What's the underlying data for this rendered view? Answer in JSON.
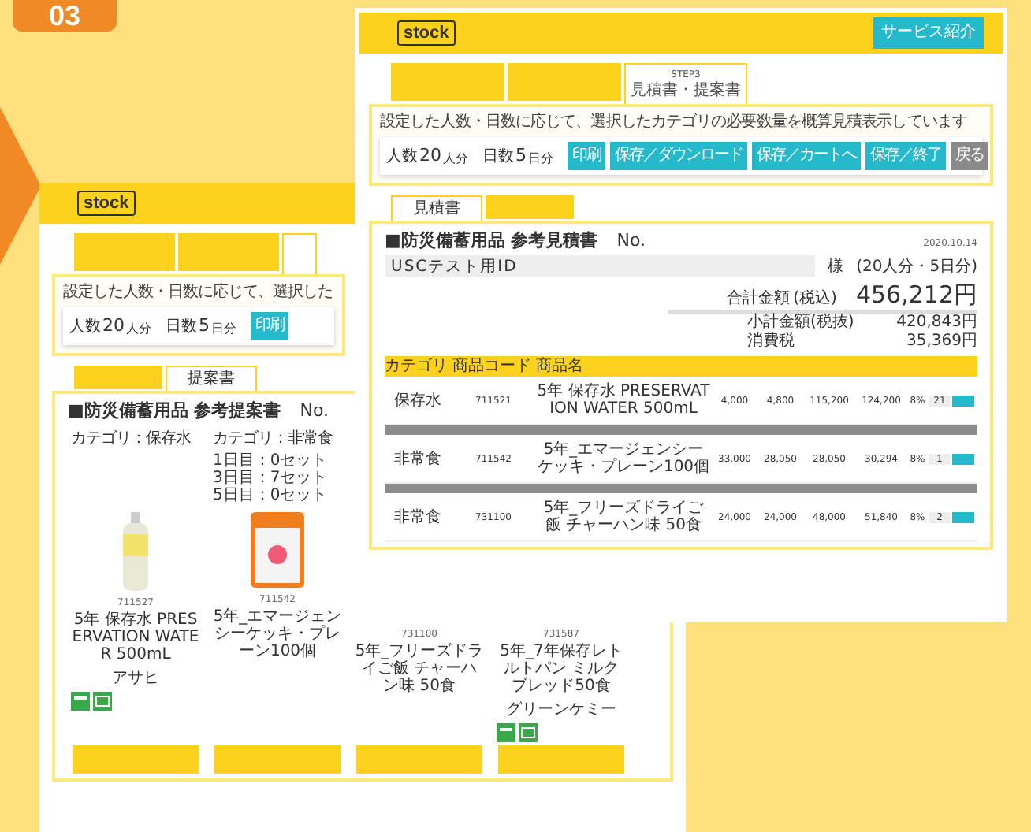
{
  "badge": "03",
  "back": {
    "logo": "stock",
    "steps": [
      {
        "selected": false
      },
      {
        "selected": false
      },
      {
        "selected": true
      }
    ],
    "description": "設定した人数・日数に応じて、選択した",
    "people": {
      "label": "人数",
      "value": "20",
      "unit": "人分"
    },
    "days": {
      "label": "日数",
      "value": "5",
      "unit": "日分"
    },
    "buttons": [
      "印刷"
    ],
    "doc_tabs": [
      {
        "selected": false
      },
      {
        "label": "提案書",
        "selected": true
      }
    ],
    "doc_title": "■防災備蓄用品 参考提案書",
    "doc_no": "No.",
    "cards": [
      {
        "kind": "bottle",
        "category": "カテゴリ：保存水",
        "code": "711527",
        "name": "5年 保存水 PRESERVATION WATER 500mL",
        "maker": "アサヒ",
        "certified": true
      },
      {
        "kind": "pack",
        "category": "カテゴリ：非常食",
        "schedule": [
          "1日目：0セット",
          "3日目：7セット",
          "5日目：0セット"
        ],
        "code": "711542",
        "name": "5年_エマージェンシーケッキ・プレーン100個",
        "certified": false
      },
      {
        "kind": "lower",
        "code": "731100",
        "name": "5年_フリーズドライご飯 チャーハン味 50食",
        "certified": false
      },
      {
        "kind": "lower",
        "code": "731587",
        "name": "5年_7年保存レトルトパン ミルクブレッド50食",
        "maker": "グリーンケミー",
        "certified": true
      }
    ]
  },
  "front": {
    "logo": "stock",
    "header_button": "サービス紹介",
    "steps": [
      {
        "selected": false
      },
      {
        "selected": false
      },
      {
        "selected": true,
        "step": "STEP3",
        "label": "見積書・提案書"
      }
    ],
    "description": "設定した人数・日数に応じて、選択したカテゴリの必要数量を概算見積表示しています",
    "people": {
      "label": "人数",
      "value": "20",
      "unit": "人分"
    },
    "days": {
      "label": "日数",
      "value": "5",
      "unit": "日分"
    },
    "buttons": [
      {
        "label": "印刷",
        "kind": "primary"
      },
      {
        "label": "保存／ダウンロード",
        "kind": "primary"
      },
      {
        "label": "保存／カートへ",
        "kind": "primary"
      },
      {
        "label": "保存／終了",
        "kind": "primary"
      },
      {
        "label": "戻る",
        "kind": "secondary"
      }
    ],
    "doc_tabs": [
      {
        "label": "見積書",
        "selected": true
      },
      {
        "selected": false
      }
    ],
    "doc_title": "■防災備蓄用品 参考見積書",
    "doc_no": "No.",
    "date": "2020.10.14",
    "customer": "USCテスト用ID",
    "honorific": "様",
    "scope": "(20人分・5日分)",
    "total_label": "合計金額",
    "total_note": "(税込)",
    "total": "456,212円",
    "subtotals": [
      {
        "label": "小計金額(税抜)",
        "value": "420,843円"
      },
      {
        "label": "消費税",
        "value": "35,369円"
      }
    ],
    "table": {
      "columns": [
        "カテゴリ",
        "商品コード",
        "商品名"
      ],
      "rows": [
        {
          "kind": "item",
          "cells": [
            "保存水",
            "711521",
            "5年 保存水 PRESERVATION WATER 500mL",
            "4,000",
            "4,800",
            "115,200",
            "124,200",
            "8%",
            "21"
          ]
        },
        {
          "kind": "summary"
        },
        {
          "kind": "item",
          "cells": [
            "非常食",
            "711542",
            "5年_エマージェンシーケッキ・プレーン100個",
            "33,000",
            "28,050",
            "28,050",
            "30,294",
            "8%",
            "1"
          ]
        },
        {
          "kind": "summary"
        },
        {
          "kind": "item",
          "cells": [
            "非常食",
            "731100",
            "5年_フリーズドライご飯 チャーハン味 50食",
            "24,000",
            "24,000",
            "48,000",
            "51,840",
            "8%",
            "2"
          ]
        }
      ]
    }
  }
}
